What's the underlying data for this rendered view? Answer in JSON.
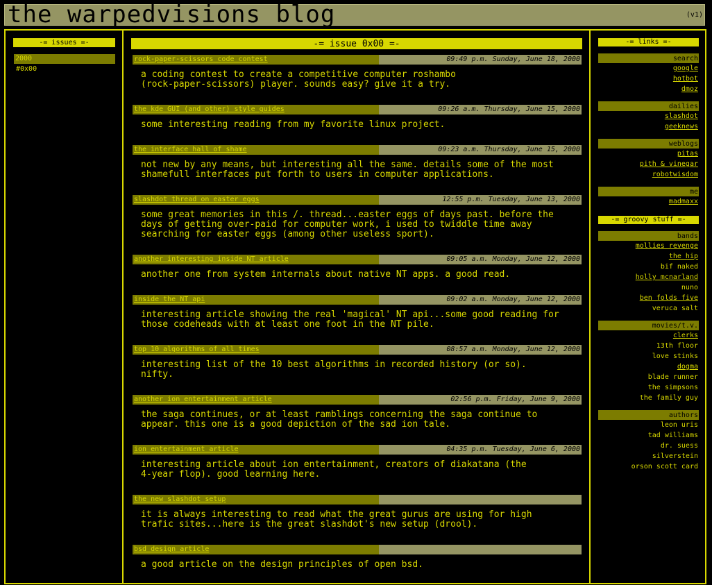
{
  "site": {
    "title": "the warpedvisions blog",
    "version": "(v1)"
  },
  "issues": {
    "header": "-= issues =-",
    "year": "2000",
    "issue": "#0x00"
  },
  "main": {
    "header": "-= issue 0x00 =-",
    "posts": [
      {
        "title": "rock-paper-scissors code contest",
        "date": "09:49 p.m. Sunday, June 18, 2000",
        "body": "a coding contest to create a competitive computer roshambo\n(rock-paper-scissors) player. sounds easy? give it a try."
      },
      {
        "title": "the kde GUI (and other) style guides",
        "date": "09:26 a.m. Thursday, June 15, 2000",
        "body": "some interesting reading from my favorite linux project."
      },
      {
        "title": "the interface hall of shame",
        "date": "09:23 a.m. Thursday, June 15, 2000",
        "body": "not new by any means, but interesting all the same. details some of the most\nshamefull interfaces put forth to users in computer applications."
      },
      {
        "title": "slashdot thread on easter eggs",
        "date": "12:55 p.m. Tuesday, June 13, 2000",
        "body": "some great memories in this /. thread...easter eggs of days past. before the\ndays of getting over-paid for computer work, i used to twiddle time away\nsearching for easter eggs (among other useless sport)."
      },
      {
        "title": "another interesting inside NT article",
        "date": "09:05 a.m. Monday, June 12, 2000",
        "body": "another one from system internals about native NT apps. a good read."
      },
      {
        "title": "inside the NT api",
        "date": "09:02 a.m. Monday, June 12, 2000",
        "body": "interesting article showing the real 'magical' NT api...some good reading for\nthose codeheads with at least one foot in the NT pile."
      },
      {
        "title": "top 10 algorithms of all times",
        "date": "08:57 a.m. Monday, June 12, 2000",
        "body": "interesting list of the 10 best algorithms in recorded history (or so).\nnifty."
      },
      {
        "title": "another ion entertainment article",
        "date": "02:56 p.m. Friday, June 9, 2000",
        "body": "the saga continues, or at least ramblings concerning the saga continue to\nappear. this one is a good depiction of the sad ion tale."
      },
      {
        "title": "ion entertainment article",
        "date": "04:35 p.m. Tuesday, June 6, 2000",
        "body": "interesting article about ion entertainment, creators of diakatana (the\n4-year flop). good learning here."
      },
      {
        "title": "the new slashdot setup",
        "date": "",
        "body": "it is always interesting to read what the great gurus are using for high\ntrafic sites...here is the great slashdot's new setup (drool)."
      },
      {
        "title": "bsd design article",
        "date": "",
        "body": "a good article on the design principles of open bsd."
      }
    ]
  },
  "links": {
    "header": "-= links =-",
    "groups": [
      {
        "name": "search",
        "items": [
          {
            "label": "google",
            "link": true
          },
          {
            "label": "hotbot",
            "link": true
          },
          {
            "label": "dmoz",
            "link": true
          }
        ]
      },
      {
        "name": "dailies",
        "items": [
          {
            "label": "slashdot",
            "link": true
          },
          {
            "label": "geeknews",
            "link": true
          }
        ]
      },
      {
        "name": "weblogs",
        "items": [
          {
            "label": "pitas",
            "link": true
          },
          {
            "label": "pith & vinegar",
            "link": true
          },
          {
            "label": "robotwisdom",
            "link": true
          }
        ]
      },
      {
        "name": "me",
        "items": [
          {
            "label": "madmaxx",
            "link": true
          }
        ]
      }
    ]
  },
  "groovy": {
    "header": "-= groovy stuff =-",
    "groups": [
      {
        "name": "bands",
        "items": [
          {
            "label": "mollies revenge",
            "link": true
          },
          {
            "label": "the hip",
            "link": true
          },
          {
            "label": "bif naked",
            "link": false
          },
          {
            "label": "holly mcnarland",
            "link": true
          },
          {
            "label": "nuno",
            "link": false
          },
          {
            "label": "ben folds five",
            "link": true
          },
          {
            "label": "veruca salt",
            "link": false
          }
        ]
      },
      {
        "name": "movies/t.v.",
        "items": [
          {
            "label": "clerks",
            "link": true
          },
          {
            "label": "13th floor",
            "link": false
          },
          {
            "label": "love stinks",
            "link": false
          },
          {
            "label": "dogma",
            "link": true
          },
          {
            "label": "blade runner",
            "link": false
          },
          {
            "label": "the simpsons",
            "link": false
          },
          {
            "label": "the family guy",
            "link": false
          }
        ]
      },
      {
        "name": "authors",
        "items": [
          {
            "label": "leon uris",
            "link": false
          },
          {
            "label": "tad williams",
            "link": false
          },
          {
            "label": "dr. suess",
            "link": false
          },
          {
            "label": "silverstein",
            "link": false
          },
          {
            "label": "orson scott card",
            "link": false
          }
        ]
      }
    ]
  }
}
